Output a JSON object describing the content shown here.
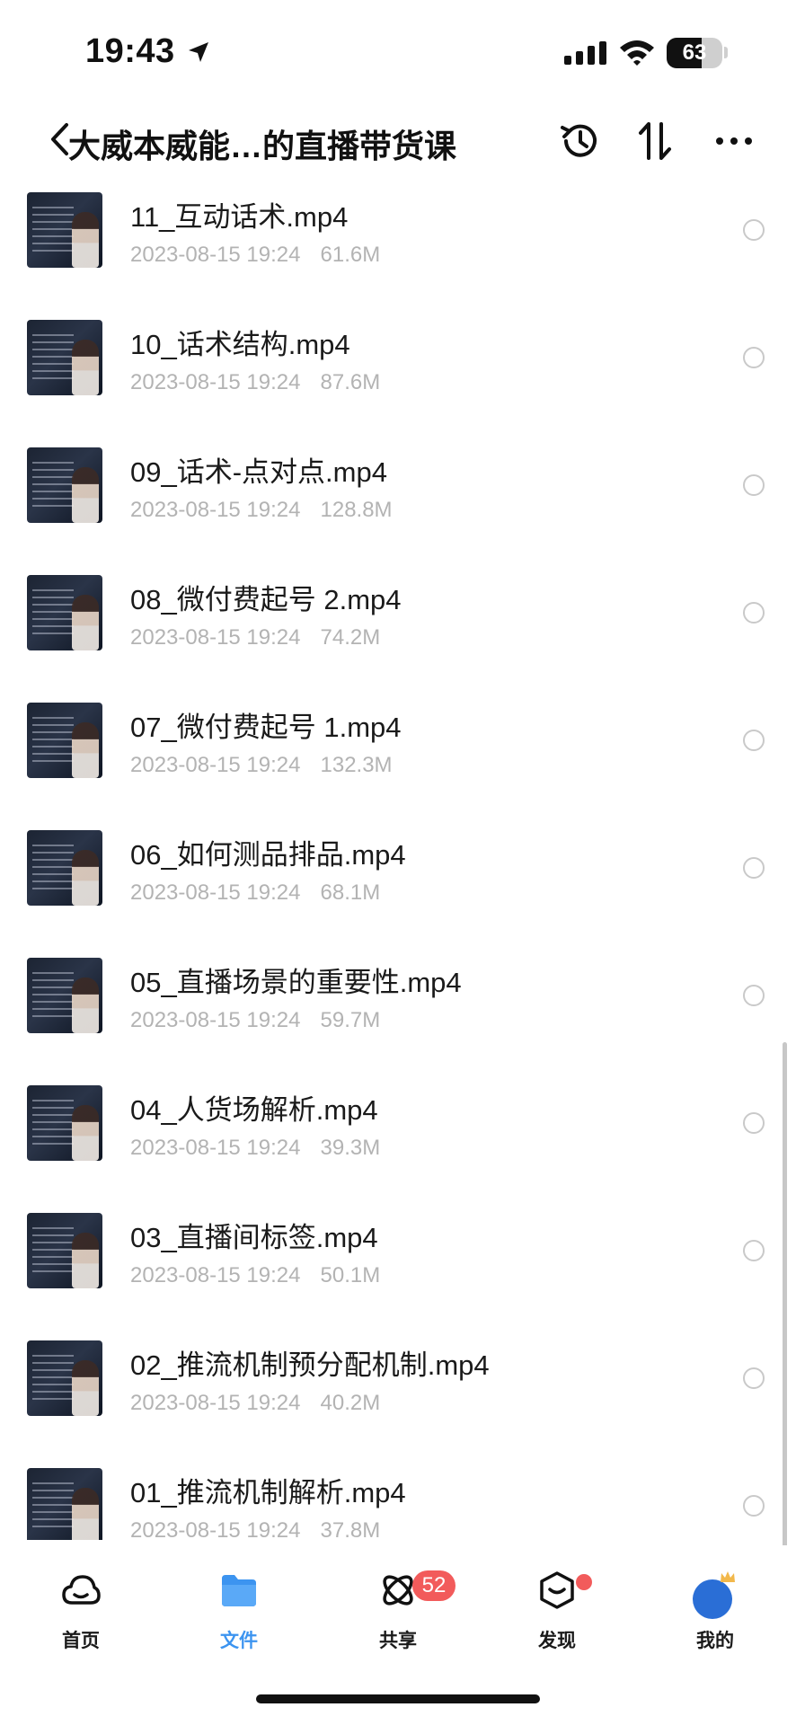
{
  "status_bar": {
    "time": "19:43",
    "battery": "63",
    "battery_level": 0.63
  },
  "header": {
    "back_label": "‹",
    "title": "大威本威能…的直播带货课"
  },
  "files": [
    {
      "name": "11_互动话术.mp4",
      "date": "2023-08-15 19:24",
      "size": "61.6M"
    },
    {
      "name": "10_话术结构.mp4",
      "date": "2023-08-15 19:24",
      "size": "87.6M"
    },
    {
      "name": "09_话术-点对点.mp4",
      "date": "2023-08-15 19:24",
      "size": "128.8M"
    },
    {
      "name": "08_微付费起号 2.mp4",
      "date": "2023-08-15 19:24",
      "size": "74.2M"
    },
    {
      "name": "07_微付费起号 1.mp4",
      "date": "2023-08-15 19:24",
      "size": "132.3M"
    },
    {
      "name": "06_如何测品排品.mp4",
      "date": "2023-08-15 19:24",
      "size": "68.1M"
    },
    {
      "name": "05_直播场景的重要性.mp4",
      "date": "2023-08-15 19:24",
      "size": "59.7M"
    },
    {
      "name": "04_人货场解析.mp4",
      "date": "2023-08-15 19:24",
      "size": "39.3M"
    },
    {
      "name": "03_直播间标签.mp4",
      "date": "2023-08-15 19:24",
      "size": "50.1M"
    },
    {
      "name": "02_推流机制预分配机制.mp4",
      "date": "2023-08-15 19:24",
      "size": "40.2M"
    },
    {
      "name": "01_推流机制解析.mp4",
      "date": "2023-08-15 19:24",
      "size": "37.8M"
    }
  ],
  "tabs": [
    {
      "label": "首页",
      "icon": "cloud-icon"
    },
    {
      "label": "文件",
      "icon": "folder-icon",
      "active": true
    },
    {
      "label": "共享",
      "icon": "share-icon",
      "badge": "52"
    },
    {
      "label": "发现",
      "icon": "discover-icon",
      "dot": true
    },
    {
      "label": "我的",
      "icon": "avatar-icon"
    }
  ],
  "colors": {
    "accent": "#3c94f0",
    "badge": "#f25b5b",
    "meta_text": "#b3b3b3"
  }
}
